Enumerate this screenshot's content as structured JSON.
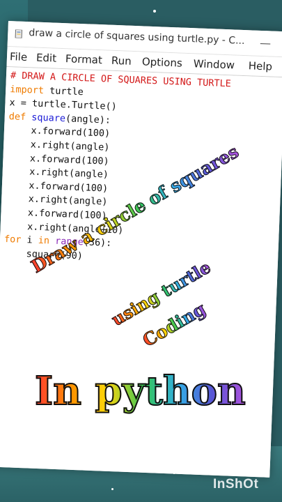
{
  "window": {
    "title": "draw a circle of squares using turtle.py - C...",
    "minimize_glyph": "—"
  },
  "menu": {
    "items": [
      "File",
      "Edit",
      "Format",
      "Run",
      "Options",
      "Window",
      "Help"
    ]
  },
  "code": {
    "lines": [
      "# DRAW A CIRCLE OF SQUARES USING TURTLE",
      "import turtle",
      "x = turtle.Turtle()",
      "def square(angle):",
      "    x.forward(100)",
      "    x.right(angle)",
      "    x.forward(100)",
      "    x.right(angle)",
      "    x.forward(100)",
      "    x.right(angle)",
      "    x.forward(100)",
      "    x.right(angle+10)",
      "for i in range(36):",
      "    square(90)"
    ]
  },
  "overlay": {
    "line1": "Draw a circle of squares",
    "line2": "using turtle",
    "line3": "Coding",
    "headline": "In python"
  },
  "watermark": "InShOt",
  "colors": {
    "comment": "#d31818",
    "keyword": "#ef7b00",
    "def_name": "#1b1bd6",
    "builtin": "#8a2ab8",
    "background_teal": "#2a5d62"
  },
  "icons": {
    "app": "python-file-icon",
    "minimize": "minimize-icon"
  }
}
